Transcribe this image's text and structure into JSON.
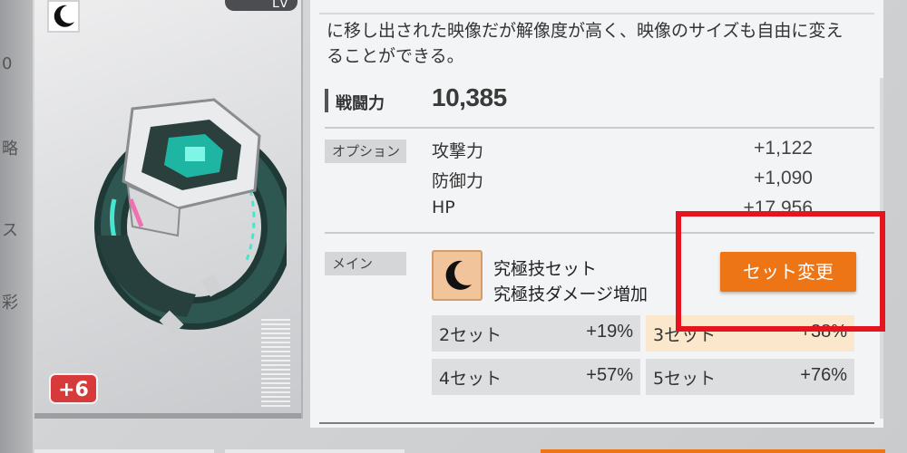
{
  "item": {
    "rank": "Lv",
    "enhance_level": "+6",
    "set_icon": "crescent-moon-icon",
    "art": "ring-device-illustration"
  },
  "detail": {
    "description": "に移し出された映像だが解像度が高く、映像のサイズも自由に変えることができる。",
    "power": {
      "label": "戦闘力",
      "value": "10,385"
    },
    "options": {
      "tag": "オプション",
      "rows": [
        {
          "name": "攻撃力",
          "value": "+1,122"
        },
        {
          "name": "防御力",
          "value": "+1,090"
        },
        {
          "name": "HP",
          "value": "+17,956"
        }
      ]
    },
    "main": {
      "tag": "メイン",
      "set_name": "究極技セット",
      "set_effect": "究極技ダメージ増加",
      "change_button": "セット変更",
      "bonuses": [
        {
          "label": "2セット",
          "value": "+19%"
        },
        {
          "label": "3セット",
          "value": "+38%"
        },
        {
          "label": "4セット",
          "value": "+57%"
        },
        {
          "label": "5セット",
          "value": "+76%"
        }
      ]
    }
  },
  "colors": {
    "accent": "#ee7516",
    "highlight_box": "#e5141f",
    "badge": "#d63a3a"
  }
}
